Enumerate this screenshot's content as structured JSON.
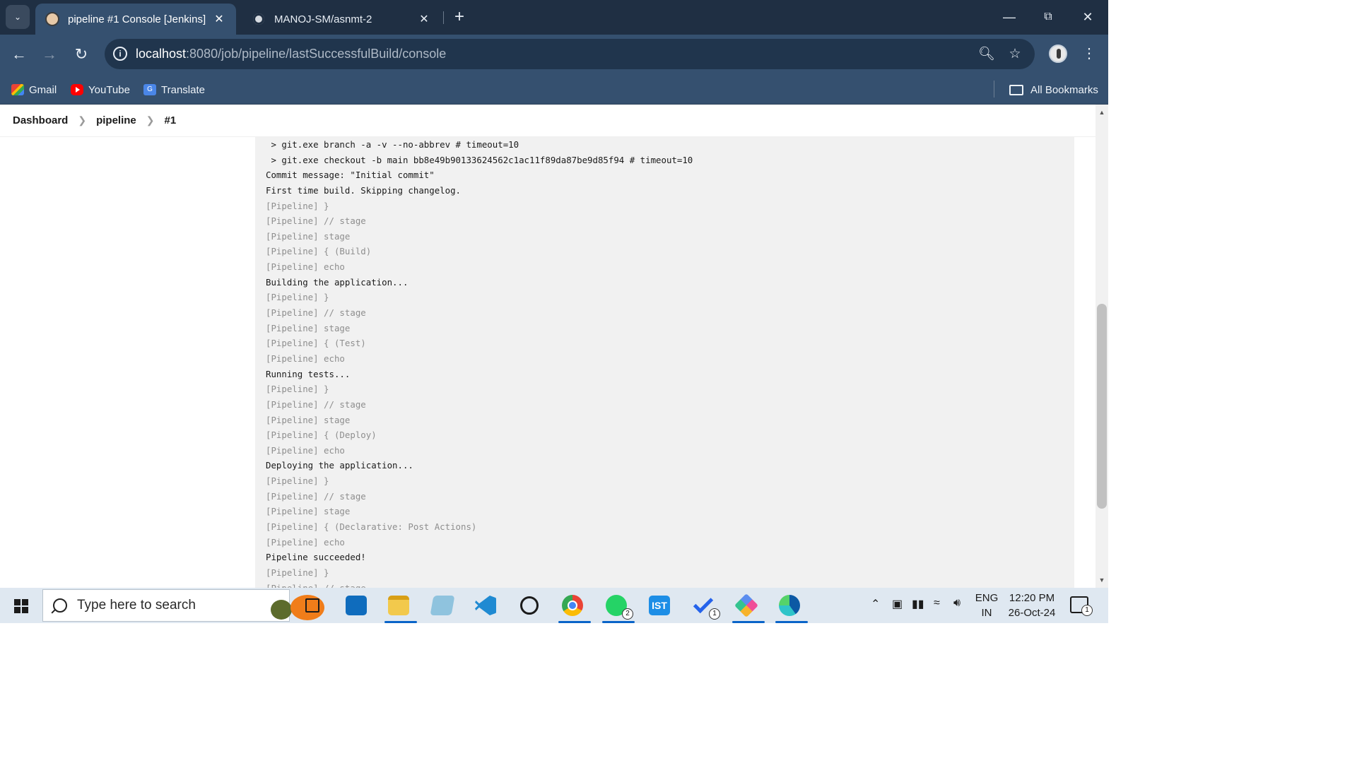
{
  "browser": {
    "tabs": [
      {
        "title": "pipeline #1 Console [Jenkins]",
        "active": true
      },
      {
        "title": "MANOJ-SM/asnmt-2",
        "active": false
      }
    ],
    "url_host": "localhost",
    "url_rest": ":8080/job/pipeline/lastSuccessfulBuild/console",
    "bookmarks": [
      "Gmail",
      "YouTube",
      "Translate"
    ],
    "all_bookmarks": "All Bookmarks",
    "translate_icon_text": "G"
  },
  "breadcrumb": [
    "Dashboard",
    "pipeline",
    "#1"
  ],
  "console": {
    "lines": [
      {
        "text": " > git.exe branch -a -v --no-abbrev # timeout=10",
        "pipe": false
      },
      {
        "text": " > git.exe checkout -b main bb8e49b90133624562c1ac11f89da87be9d85f94 # timeout=10",
        "pipe": false
      },
      {
        "text": "Commit message: \"Initial commit\"",
        "pipe": false
      },
      {
        "text": "First time build. Skipping changelog.",
        "pipe": false
      },
      {
        "text": "[Pipeline] }",
        "pipe": true
      },
      {
        "text": "[Pipeline] // stage",
        "pipe": true
      },
      {
        "text": "[Pipeline] stage",
        "pipe": true
      },
      {
        "text": "[Pipeline] { (Build)",
        "pipe": true
      },
      {
        "text": "[Pipeline] echo",
        "pipe": true
      },
      {
        "text": "Building the application...",
        "pipe": false
      },
      {
        "text": "[Pipeline] }",
        "pipe": true
      },
      {
        "text": "[Pipeline] // stage",
        "pipe": true
      },
      {
        "text": "[Pipeline] stage",
        "pipe": true
      },
      {
        "text": "[Pipeline] { (Test)",
        "pipe": true
      },
      {
        "text": "[Pipeline] echo",
        "pipe": true
      },
      {
        "text": "Running tests...",
        "pipe": false
      },
      {
        "text": "[Pipeline] }",
        "pipe": true
      },
      {
        "text": "[Pipeline] // stage",
        "pipe": true
      },
      {
        "text": "[Pipeline] stage",
        "pipe": true
      },
      {
        "text": "[Pipeline] { (Deploy)",
        "pipe": true
      },
      {
        "text": "[Pipeline] echo",
        "pipe": true
      },
      {
        "text": "Deploying the application...",
        "pipe": false
      },
      {
        "text": "[Pipeline] }",
        "pipe": true
      },
      {
        "text": "[Pipeline] // stage",
        "pipe": true
      },
      {
        "text": "[Pipeline] stage",
        "pipe": true
      },
      {
        "text": "[Pipeline] { (Declarative: Post Actions)",
        "pipe": true
      },
      {
        "text": "[Pipeline] echo",
        "pipe": true
      },
      {
        "text": "Pipeline succeeded!",
        "pipe": false
      },
      {
        "text": "[Pipeline] }",
        "pipe": true
      },
      {
        "text": "[Pipeline] // stage",
        "pipe": true
      }
    ]
  },
  "taskbar": {
    "search_placeholder": "Type here to search",
    "lang_line1": "ENG",
    "lang_line2": "IN",
    "time": "12:20 PM",
    "date": "26-Oct-24",
    "whatsapp_badge": "2",
    "todo_badge": "1",
    "notification_badge": "1",
    "ist_label": "IST"
  },
  "colors": {
    "titlebar": "#1f2f43",
    "toolbar": "#35506f",
    "console_bg": "#f1f1f1",
    "taskbar": "#dfe8f1"
  }
}
